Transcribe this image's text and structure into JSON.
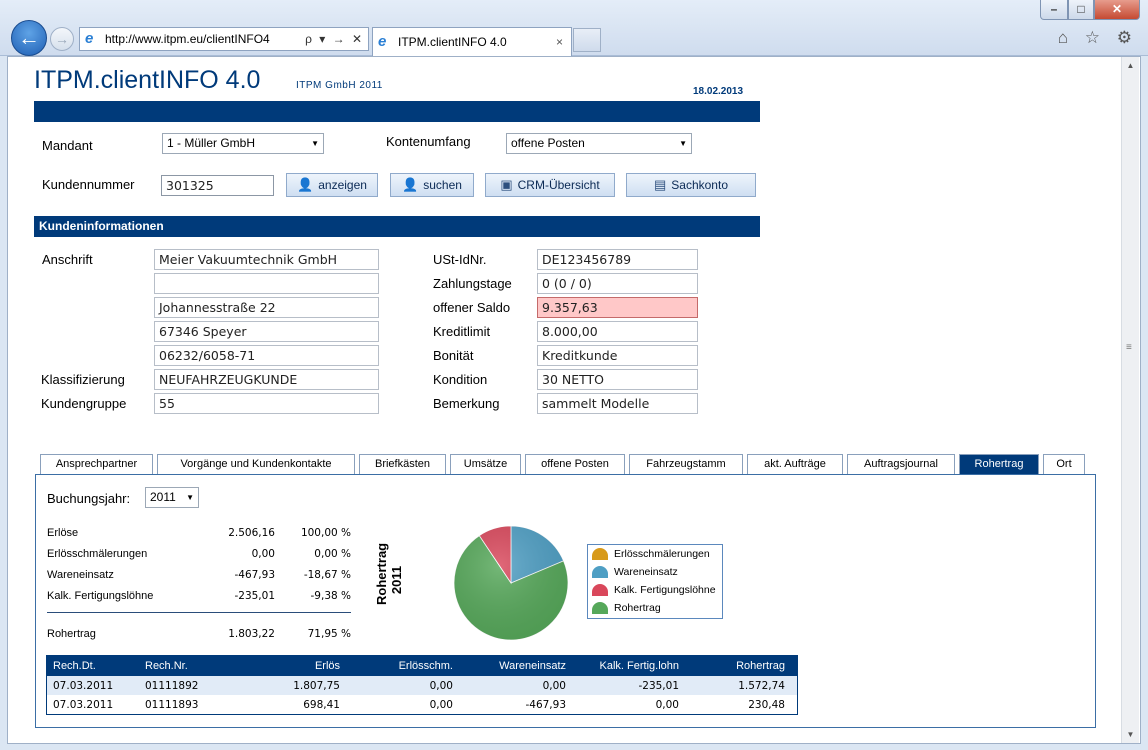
{
  "browser": {
    "url": "http://www.itpm.eu/clientINFO4",
    "tab_title": "ITPM.clientINFO 4.0",
    "tab_close": "×",
    "address_tools": "ρ ▾ → ✕",
    "win_min": "–",
    "win_max": "□",
    "win_close": "✕",
    "back": "←",
    "forward": "→",
    "right_icons": "⌂ ☆ ⚙"
  },
  "header": {
    "title": "ITPM.clientINFO 4.0",
    "company": "ITPM GmbH 2011",
    "date": "18.02.2013"
  },
  "filters": {
    "mandant_label": "Mandant",
    "mandant_value": "1 - Müller GmbH",
    "kontenumfang_label": "Kontenumfang",
    "kontenumfang_value": "offene Posten",
    "kundennummer_label": "Kundennummer",
    "kundennummer_value": "301325",
    "buttons": {
      "anzeigen": "anzeigen",
      "suchen": "suchen",
      "crm": "CRM-Übersicht",
      "sachkonto": "Sachkonto"
    }
  },
  "kundeninfo": {
    "section_title": "Kundeninformationen",
    "anschrift_label": "Anschrift",
    "address": [
      "Meier Vakuumtechnik GmbH",
      "",
      "Johannesstraße 22",
      "67346 Speyer",
      "06232/6058-71"
    ],
    "klassifizierung_label": "Klassifizierung",
    "klassifizierung": "NEUFAHRZEUGKUNDE",
    "kundengruppe_label": "Kundengruppe",
    "kundengruppe": "55",
    "ust_label": "USt-IdNr.",
    "ust": "DE123456789",
    "zahlungstage_label": "Zahlungstage",
    "zahlungstage": "0 (0 / 0)",
    "saldo_label": "offener Saldo",
    "saldo": "9.357,63",
    "kreditlimit_label": "Kreditlimit",
    "kreditlimit": "8.000,00",
    "bonitaet_label": "Bonität",
    "bonitaet": "Kreditkunde",
    "kondition_label": "Kondition",
    "kondition": "30 NETTO",
    "bemerkung_label": "Bemerkung",
    "bemerkung": "sammelt Modelle"
  },
  "tabs": [
    {
      "label": "Ansprechpartner"
    },
    {
      "label": "Vorgänge und Kundenkontakte"
    },
    {
      "label": "Briefkästen"
    },
    {
      "label": "Umsätze"
    },
    {
      "label": "offene Posten"
    },
    {
      "label": "Fahrzeugstamm"
    },
    {
      "label": "akt. Aufträge"
    },
    {
      "label": "Auftragsjournal"
    },
    {
      "label": "Rohertrag"
    },
    {
      "label": "Ort"
    }
  ],
  "rohertrag": {
    "year_label": "Buchungsjahr:",
    "year_value": "2011",
    "rows": [
      {
        "name": "Erlöse",
        "value": "2.506,16",
        "percent": "100,00 %"
      },
      {
        "name": "Erlösschmälerungen",
        "value": "0,00",
        "percent": "0,00 %"
      },
      {
        "name": "Wareneinsatz",
        "value": "-467,93",
        "percent": "-18,67 %"
      },
      {
        "name": "Kalk. Fertigungslöhne",
        "value": "-235,01",
        "percent": "-9,38 %"
      }
    ],
    "total": {
      "name": "Rohertrag",
      "value": "1.803,22",
      "percent": "71,95 %"
    },
    "chart_title_1": "Rohertrag",
    "chart_title_2": "2011"
  },
  "chart_data": {
    "type": "pie",
    "title": "Rohertrag 2011",
    "legend": "right",
    "slices": [
      {
        "name": "Erlösschmälerungen",
        "value": 0.0,
        "color": "#d89a1a"
      },
      {
        "name": "Wareneinsatz",
        "value": 467.93,
        "color": "#4f9fc4"
      },
      {
        "name": "Kalk. Fertigungslöhne",
        "value": 235.01,
        "color": "#d9475b"
      },
      {
        "name": "Rohertrag",
        "value": 1803.22,
        "color": "#56a85a"
      }
    ]
  },
  "table": {
    "headers": [
      "Rech.Dt.",
      "Rech.Nr.",
      "Erlös",
      "Erlösschm.",
      "Wareneinsatz",
      "Kalk. Fertig.lohn",
      "Rohertrag"
    ],
    "rows": [
      [
        "07.03.2011",
        "01111892",
        "1.807,75",
        "0,00",
        "0,00",
        "-235,01",
        "1.572,74"
      ],
      [
        "07.03.2011",
        "01111893",
        "698,41",
        "0,00",
        "-467,93",
        "0,00",
        "230,48"
      ]
    ]
  },
  "icons": {
    "back": "back-arrow-icon",
    "forward": "forward-arrow-icon",
    "ie": "internet-explorer-icon",
    "user": "user-icon",
    "crm": "crm-icon",
    "ledger": "ledger-icon",
    "dropdown": "chevron-down-icon"
  }
}
